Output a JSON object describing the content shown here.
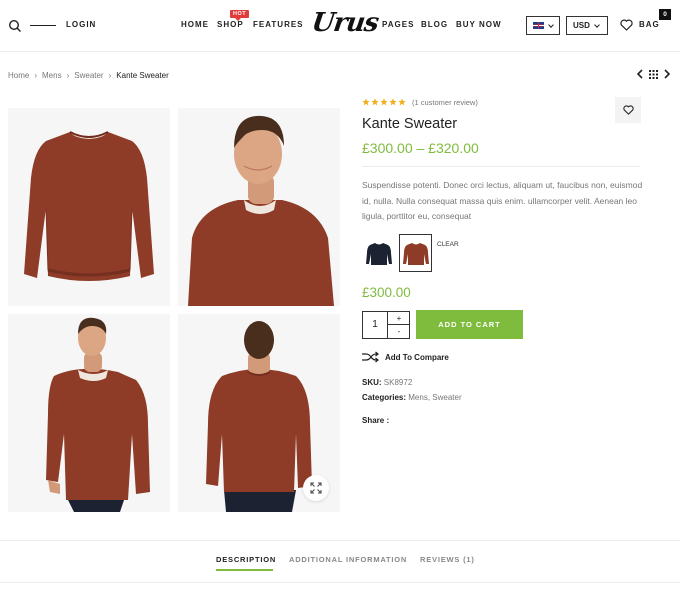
{
  "header": {
    "login": "LOGIN",
    "nav": [
      {
        "label": "HOME"
      },
      {
        "label": "SHOP",
        "badge": "HOT"
      },
      {
        "label": "FEATURES"
      },
      {
        "label": "PAGES"
      },
      {
        "label": "BLOG"
      },
      {
        "label": "BUY NOW"
      }
    ],
    "logo": "Urus",
    "currency": "USD",
    "language_flag": "uk-flag-icon",
    "bag_label": "BAG",
    "bag_count": "0"
  },
  "breadcrumb": [
    "Home",
    "Mens",
    "Sweater",
    "Kante Sweater"
  ],
  "product": {
    "rating": 5,
    "review_text": "(1 customer review)",
    "title": "Kante Sweater",
    "price_range": "£300.00 – £320.00",
    "description": "Suspendisse potenti. Donec orci lectus, aliquam ut, faucibus non, euismod id, nulla. Nulla consequat massa quis enim. ullamcorper velit. Aenean leo ligula, porttitor eu, consequat",
    "swatches": [
      {
        "color": "#1d2233",
        "selected": false
      },
      {
        "color": "#8e3b27",
        "selected": true
      }
    ],
    "clear_label": "CLEAR",
    "price": "£300.00",
    "quantity": "1",
    "qty_plus": "+",
    "qty_minus": "-",
    "add_to_cart": "ADD TO CART",
    "compare": "Add To Compare",
    "sku_label": "SKU:",
    "sku": "SK8972",
    "categories_label": "Categories:",
    "categories": [
      "Mens",
      "Sweater"
    ],
    "categories_sep": ",",
    "share_label": "Share :"
  },
  "tabs": [
    {
      "label": "DESCRIPTION",
      "active": true
    },
    {
      "label": "ADDITIONAL INFORMATION",
      "active": false
    },
    {
      "label": "REVIEWS (1)",
      "active": false
    }
  ],
  "colors": {
    "accent": "#7fbc3d",
    "badge": "#e23b3b",
    "sweater": "#8e3b27"
  }
}
